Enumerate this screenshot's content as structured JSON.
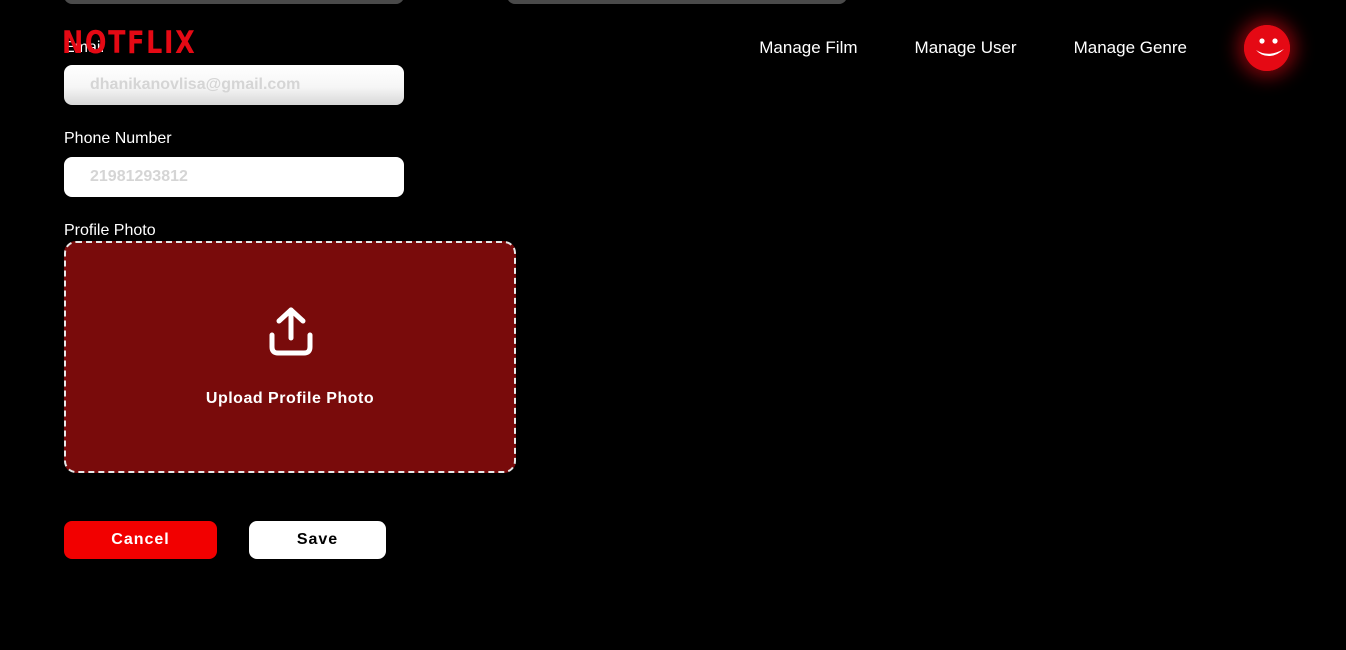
{
  "app": {
    "logo": "NOTFLIX",
    "brand_color": "#e50914"
  },
  "nav": {
    "items": [
      {
        "label": "Manage Film"
      },
      {
        "label": "Manage User"
      },
      {
        "label": "Manage Genre"
      }
    ],
    "avatar_icon": "smiley-face-icon"
  },
  "form": {
    "email": {
      "label": "Email",
      "placeholder": "dhanikanovlisa@gmail.com"
    },
    "phone": {
      "label": "Phone Number",
      "placeholder": "21981293812"
    },
    "profile_photo": {
      "label": "Profile Photo",
      "upload_label": "Upload Profile Photo",
      "upload_icon": "upload-icon",
      "box_color": "#790b0b"
    },
    "buttons": {
      "cancel": "Cancel",
      "save": "Save",
      "cancel_color": "#f20000"
    }
  }
}
